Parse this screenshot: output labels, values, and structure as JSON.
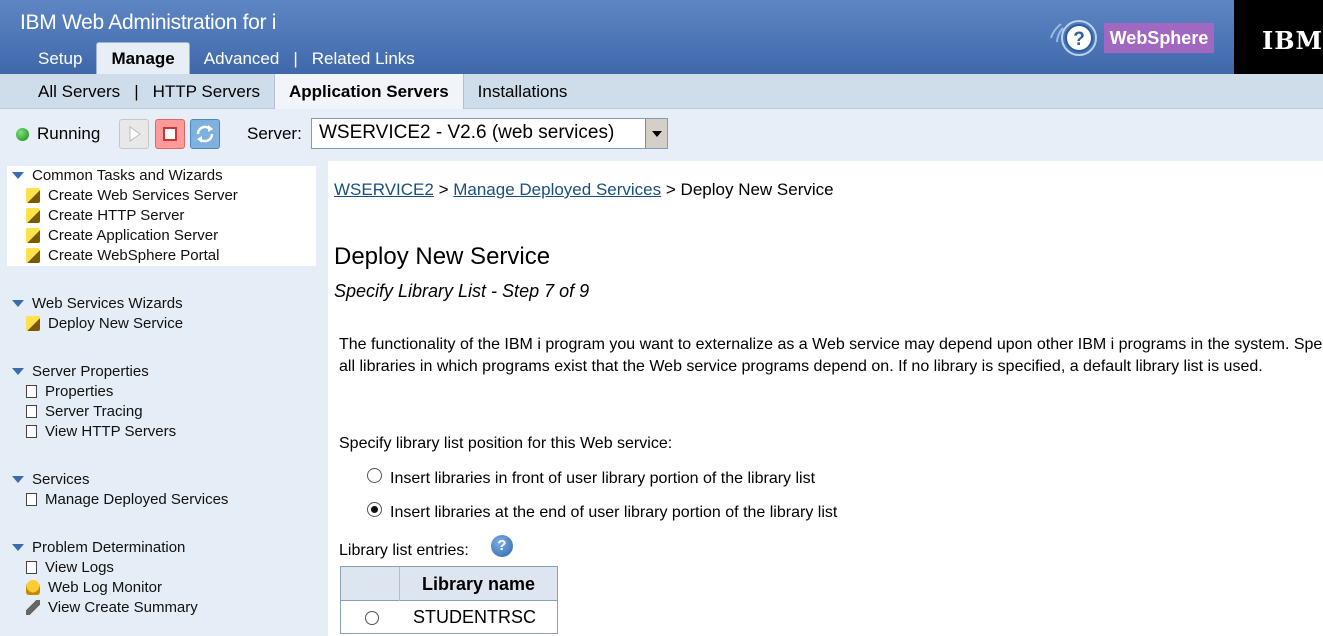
{
  "header": {
    "app_title": "IBM Web Administration for i",
    "top_tabs": [
      {
        "label": "Setup"
      },
      {
        "label": "Manage"
      },
      {
        "label": "Advanced"
      },
      {
        "label": "Related Links"
      }
    ],
    "separator": "|",
    "websphere_label": "WebSphere",
    "ibm_logo": "IBM"
  },
  "sub_tabs": [
    {
      "label": "All Servers"
    },
    {
      "label": "HTTP Servers"
    },
    {
      "label": "Application Servers"
    },
    {
      "label": "Installations"
    }
  ],
  "server_bar": {
    "status": "Running",
    "server_label": "Server:",
    "server_value": "WSERVICE2 - V2.6 (web services)"
  },
  "sidebar": {
    "groups": [
      {
        "title": "Common Tasks and Wizards",
        "items": [
          {
            "label": "Create Web Services Server",
            "icon": "wizard-icon"
          },
          {
            "label": "Create HTTP Server",
            "icon": "wizard-icon"
          },
          {
            "label": "Create Application Server",
            "icon": "wizard-icon"
          },
          {
            "label": "Create WebSphere Portal",
            "icon": "wizard-icon"
          }
        ]
      },
      {
        "title": "Web Services Wizards",
        "items": [
          {
            "label": "Deploy New Service",
            "icon": "wizard-icon"
          }
        ]
      },
      {
        "title": "Server Properties",
        "items": [
          {
            "label": "Properties",
            "icon": "page-icon"
          },
          {
            "label": "Server Tracing",
            "icon": "page-icon"
          },
          {
            "label": "View HTTP Servers",
            "icon": "page-icon"
          }
        ]
      },
      {
        "title": "Services",
        "items": [
          {
            "label": "Manage Deployed Services",
            "icon": "page-icon"
          }
        ]
      },
      {
        "title": "Problem Determination",
        "items": [
          {
            "label": "View Logs",
            "icon": "page-icon"
          },
          {
            "label": "Web Log Monitor",
            "icon": "bell-icon"
          },
          {
            "label": "View Create Summary",
            "icon": "wrench-icon"
          }
        ]
      }
    ]
  },
  "main": {
    "breadcrumb": {
      "link1": "WSERVICE2",
      "sep": ">",
      "link2": "Manage Deployed Services",
      "current": "Deploy New Service"
    },
    "title": "Deploy New Service",
    "step": "Specify Library List - Step 7 of 9",
    "description": "The functionality of the IBM i program you want to externalize as a Web service may depend upon other IBM i programs in the system. Specify all libraries in which programs exist that the Web service programs depend on. If no library is specified, a default library list is used.",
    "position_label": "Specify library list position for this Web service:",
    "options": [
      {
        "label": "Insert libraries in front of user library portion of the library list",
        "selected": false
      },
      {
        "label": "Insert libraries at the end of user library portion of the library list",
        "selected": true
      }
    ],
    "library_label": "Library list entries:",
    "table": {
      "header": "Library name",
      "rows": [
        {
          "name": "STUDENTRSC"
        }
      ]
    }
  }
}
